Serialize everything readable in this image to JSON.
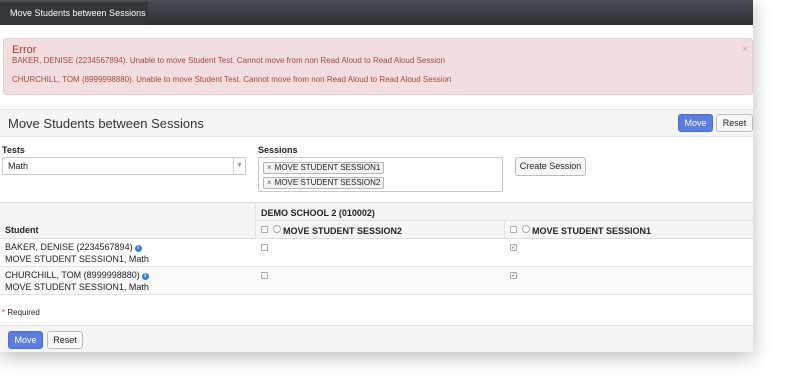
{
  "tab": {
    "title": "Move Students between Sessions"
  },
  "alert": {
    "title": "Error",
    "messages": [
      "BAKER, DENISE (2234567894). Unable to move Student Test. Cannot move from non Read Aloud to Read Aloud Session",
      "CHURCHILL, TOM (8999998880). Unable to move Student Test. Cannot move from non Read Aloud to Read Aloud Session"
    ],
    "close": "×"
  },
  "header": {
    "title": "Move Students between Sessions",
    "move_label": "Move",
    "reset_label": "Reset"
  },
  "form": {
    "tests_label": "Tests",
    "tests_value": "Math",
    "sessions_label": "Sessions",
    "sessions_selected": [
      "MOVE STUDENT SESSION1",
      "MOVE STUDENT SESSION2"
    ],
    "create_session_label": "Create Session"
  },
  "table": {
    "student_header": "Student",
    "school": "DEMO SCHOOL 2 (010002)",
    "sessions": [
      "MOVE STUDENT SESSION2",
      "MOVE STUDENT SESSION1"
    ],
    "rows": [
      {
        "name": "BAKER, DENISE (2234567894)",
        "sub": "MOVE STUDENT SESSION1, Math",
        "session2": false,
        "session1": true
      },
      {
        "name": "CHURCHILL, TOM (8999998880)",
        "sub": "MOVE STUDENT SESSION1, Math",
        "session2": false,
        "session1": true
      }
    ]
  },
  "required": {
    "star": "*",
    "text": "Required"
  },
  "footer": {
    "move_label": "Move",
    "reset_label": "Reset"
  },
  "colors": {
    "primary": "#5b7de0",
    "error_bg": "#f2dede",
    "error_text": "#a94442"
  }
}
